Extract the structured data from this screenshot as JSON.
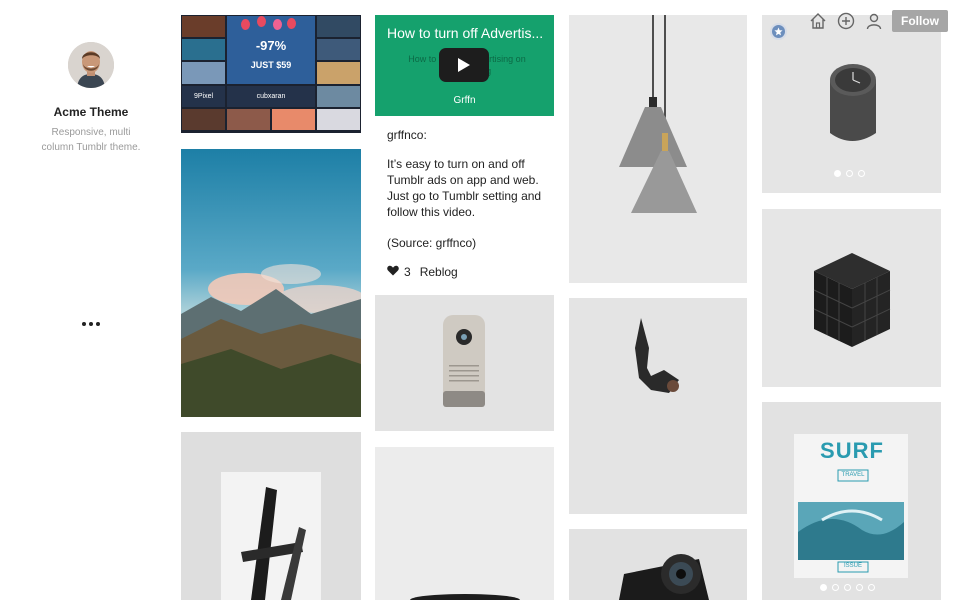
{
  "header": {
    "icons": [
      "home-icon",
      "plus-circle-icon",
      "user-icon"
    ],
    "follow_label": "Follow"
  },
  "sidebar": {
    "title": "Acme Theme",
    "description": "Responsive, multi column Tumblr theme.",
    "more_icon": "ellipsis-icon"
  },
  "collage": {
    "promo_percent": "-97%",
    "promo_price": "JUST $59",
    "logo_left": "9Pixel",
    "logo_right": "cubxaran"
  },
  "video_post": {
    "title": "How to turn off Advertis...",
    "subtitle": "How to turn off Advertising on Tumblr Blog",
    "brand": "Grffn",
    "author": "grffnco:",
    "body": "It’s easy to turn on and off Tumblr ads on app and web. Just go to Tumblr setting and follow this video.",
    "source": "(Source: grffnco)",
    "note_count": "3",
    "reblog_label": "Reblog"
  },
  "photosets": {
    "clock_dots": 3,
    "clock_active": 0,
    "magazine_dots": 5,
    "magazine_active": 0,
    "magazine_title": "SURF",
    "magazine_tag_top": "TRAVEL",
    "magazine_tag_bottom": "ISSUE"
  },
  "colors": {
    "video_green": "#15a16d",
    "follow_button": "#a6a6a6",
    "badge_blue": "#6d8fbd"
  }
}
